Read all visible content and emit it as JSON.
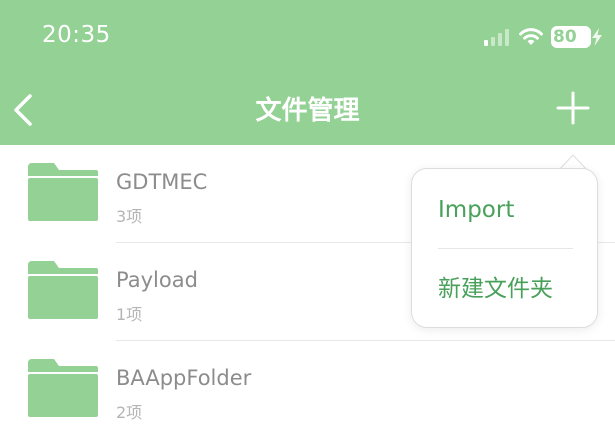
{
  "status_bar": {
    "time": "20:35",
    "battery": "80",
    "signal_icon": "signal-icon",
    "wifi_icon": "wifi-icon",
    "battery_icon": "battery-icon"
  },
  "nav": {
    "title": "文件管理",
    "back_icon": "chevron-left-icon",
    "add_icon": "plus-icon"
  },
  "files": [
    {
      "name": "GDTMEC",
      "count": "3项"
    },
    {
      "name": "Payload",
      "count": "1项"
    },
    {
      "name": "BAAppFolder",
      "count": "2项"
    }
  ],
  "popup_menu": {
    "items": [
      {
        "label": "Import"
      },
      {
        "label": "新建文件夹"
      }
    ]
  },
  "colors": {
    "header_bg": "#93d194",
    "folder": "#93d194",
    "menu_text": "#49a05a",
    "file_name": "#8c8c8c",
    "file_count": "#b5b5b5"
  }
}
